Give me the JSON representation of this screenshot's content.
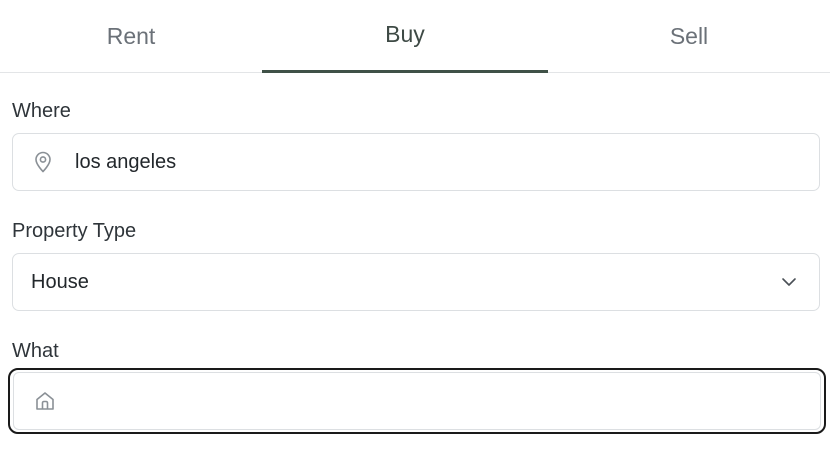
{
  "tabs": [
    {
      "label": "Rent",
      "active": false
    },
    {
      "label": "Buy",
      "active": true
    },
    {
      "label": "Sell",
      "active": false
    }
  ],
  "where": {
    "label": "Where",
    "value": "los angeles",
    "icon": "location-pin-icon"
  },
  "property_type": {
    "label": "Property Type",
    "selected": "House",
    "icon": "chevron-down-icon"
  },
  "what": {
    "label": "What",
    "value": "",
    "icon": "home-icon"
  },
  "colors": {
    "accent": "#3f5147",
    "border": "#dcdfe2",
    "focus": "#1a1a1a"
  }
}
